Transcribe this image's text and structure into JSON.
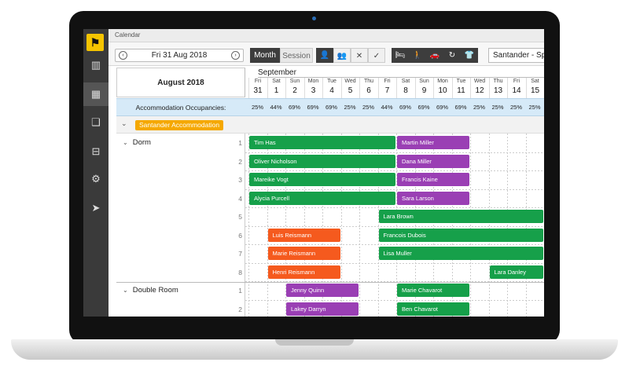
{
  "window": {
    "title": "Calendar"
  },
  "colors": {
    "green": "#16a04a",
    "purple": "#9a3fb4",
    "orange": "#f55a1e",
    "accent": "#f5a800",
    "occupancy_bg": "#d6eaf8"
  },
  "sidebar": {
    "logo_icon": "hostel-logo-icon",
    "items": [
      {
        "name": "reports-icon",
        "glyph": "▥"
      },
      {
        "name": "calendar-icon",
        "glyph": "▦",
        "active": true
      },
      {
        "name": "book-icon",
        "glyph": "❑"
      },
      {
        "name": "inbox-icon",
        "glyph": "⊟"
      },
      {
        "name": "settings-icon",
        "glyph": "⚙"
      },
      {
        "name": "send-icon",
        "glyph": "➤"
      }
    ]
  },
  "toolbar": {
    "date": "Fri 31 Aug 2018",
    "prev": "‹",
    "next": "›",
    "view_month": "Month",
    "view_session": "Session",
    "resource": "Santander - Spa"
  },
  "header": {
    "month_label": "August 2018",
    "next_month": "September",
    "days": [
      {
        "dow": "Fri",
        "num": "31"
      },
      {
        "dow": "Sat",
        "num": "1"
      },
      {
        "dow": "Sun",
        "num": "2"
      },
      {
        "dow": "Mon",
        "num": "3"
      },
      {
        "dow": "Tue",
        "num": "4"
      },
      {
        "dow": "Wed",
        "num": "5"
      },
      {
        "dow": "Thu",
        "num": "6"
      },
      {
        "dow": "Fri",
        "num": "7"
      },
      {
        "dow": "Sat",
        "num": "8"
      },
      {
        "dow": "Sun",
        "num": "9"
      },
      {
        "dow": "Mon",
        "num": "10"
      },
      {
        "dow": "Tue",
        "num": "11"
      },
      {
        "dow": "Wed",
        "num": "12"
      },
      {
        "dow": "Thu",
        "num": "13"
      },
      {
        "dow": "Fri",
        "num": "14"
      },
      {
        "dow": "Sat",
        "num": "15"
      }
    ]
  },
  "occupancy": {
    "label": "Accommodation Occupancies:",
    "values": [
      "25%",
      "44%",
      "69%",
      "69%",
      "69%",
      "25%",
      "25%",
      "44%",
      "69%",
      "69%",
      "69%",
      "69%",
      "25%",
      "25%",
      "25%",
      "25%"
    ]
  },
  "group": {
    "label": "Santander Accommodation"
  },
  "rooms": [
    {
      "name": "Dorm",
      "rows": [
        "1",
        "2",
        "3",
        "4",
        "5",
        "6",
        "7",
        "8"
      ]
    },
    {
      "name": "Double Room",
      "rows": [
        "1",
        "2"
      ]
    }
  ],
  "bookings": [
    {
      "guest": "Tim Has",
      "row": 0,
      "start": 0,
      "days": 8,
      "color": "green"
    },
    {
      "guest": "Martin Miller",
      "row": 0,
      "start": 8,
      "days": 4,
      "color": "purple"
    },
    {
      "guest": "Oliver Nicholson",
      "row": 1,
      "start": 0,
      "days": 8,
      "color": "green"
    },
    {
      "guest": "Dana Miller",
      "row": 1,
      "start": 8,
      "days": 4,
      "color": "purple"
    },
    {
      "guest": "Mareike Vogt",
      "row": 2,
      "start": 0,
      "days": 8,
      "color": "green"
    },
    {
      "guest": "Francis Kaine",
      "row": 2,
      "start": 8,
      "days": 4,
      "color": "purple"
    },
    {
      "guest": "Alycia Purcell",
      "row": 3,
      "start": 0,
      "days": 8,
      "color": "green"
    },
    {
      "guest": "Sara Larson",
      "row": 3,
      "start": 8,
      "days": 4,
      "color": "purple"
    },
    {
      "guest": "Lara Brown",
      "row": 4,
      "start": 7,
      "days": 9,
      "color": "green"
    },
    {
      "guest": "Luis Reismann",
      "row": 5,
      "start": 1,
      "days": 4,
      "color": "orange"
    },
    {
      "guest": "Francois Dubois",
      "row": 5,
      "start": 7,
      "days": 9,
      "color": "green"
    },
    {
      "guest": "Marie Reismann",
      "row": 6,
      "start": 1,
      "days": 4,
      "color": "orange"
    },
    {
      "guest": "Lisa Muller",
      "row": 6,
      "start": 7,
      "days": 9,
      "color": "green"
    },
    {
      "guest": "Henri Reismann",
      "row": 7,
      "start": 1,
      "days": 4,
      "color": "orange"
    },
    {
      "guest": "Lara Danley",
      "row": 7,
      "start": 13,
      "days": 3,
      "color": "green"
    },
    {
      "guest": "Jenny Quinn",
      "row": 8,
      "start": 2,
      "days": 4,
      "color": "purple"
    },
    {
      "guest": "Marie Chavarot",
      "row": 8,
      "start": 8,
      "days": 4,
      "color": "green"
    },
    {
      "guest": "Lakey Darryn",
      "row": 9,
      "start": 2,
      "days": 4,
      "color": "purple"
    },
    {
      "guest": "Ben Chavarot",
      "row": 9,
      "start": 8,
      "days": 4,
      "color": "green"
    }
  ]
}
